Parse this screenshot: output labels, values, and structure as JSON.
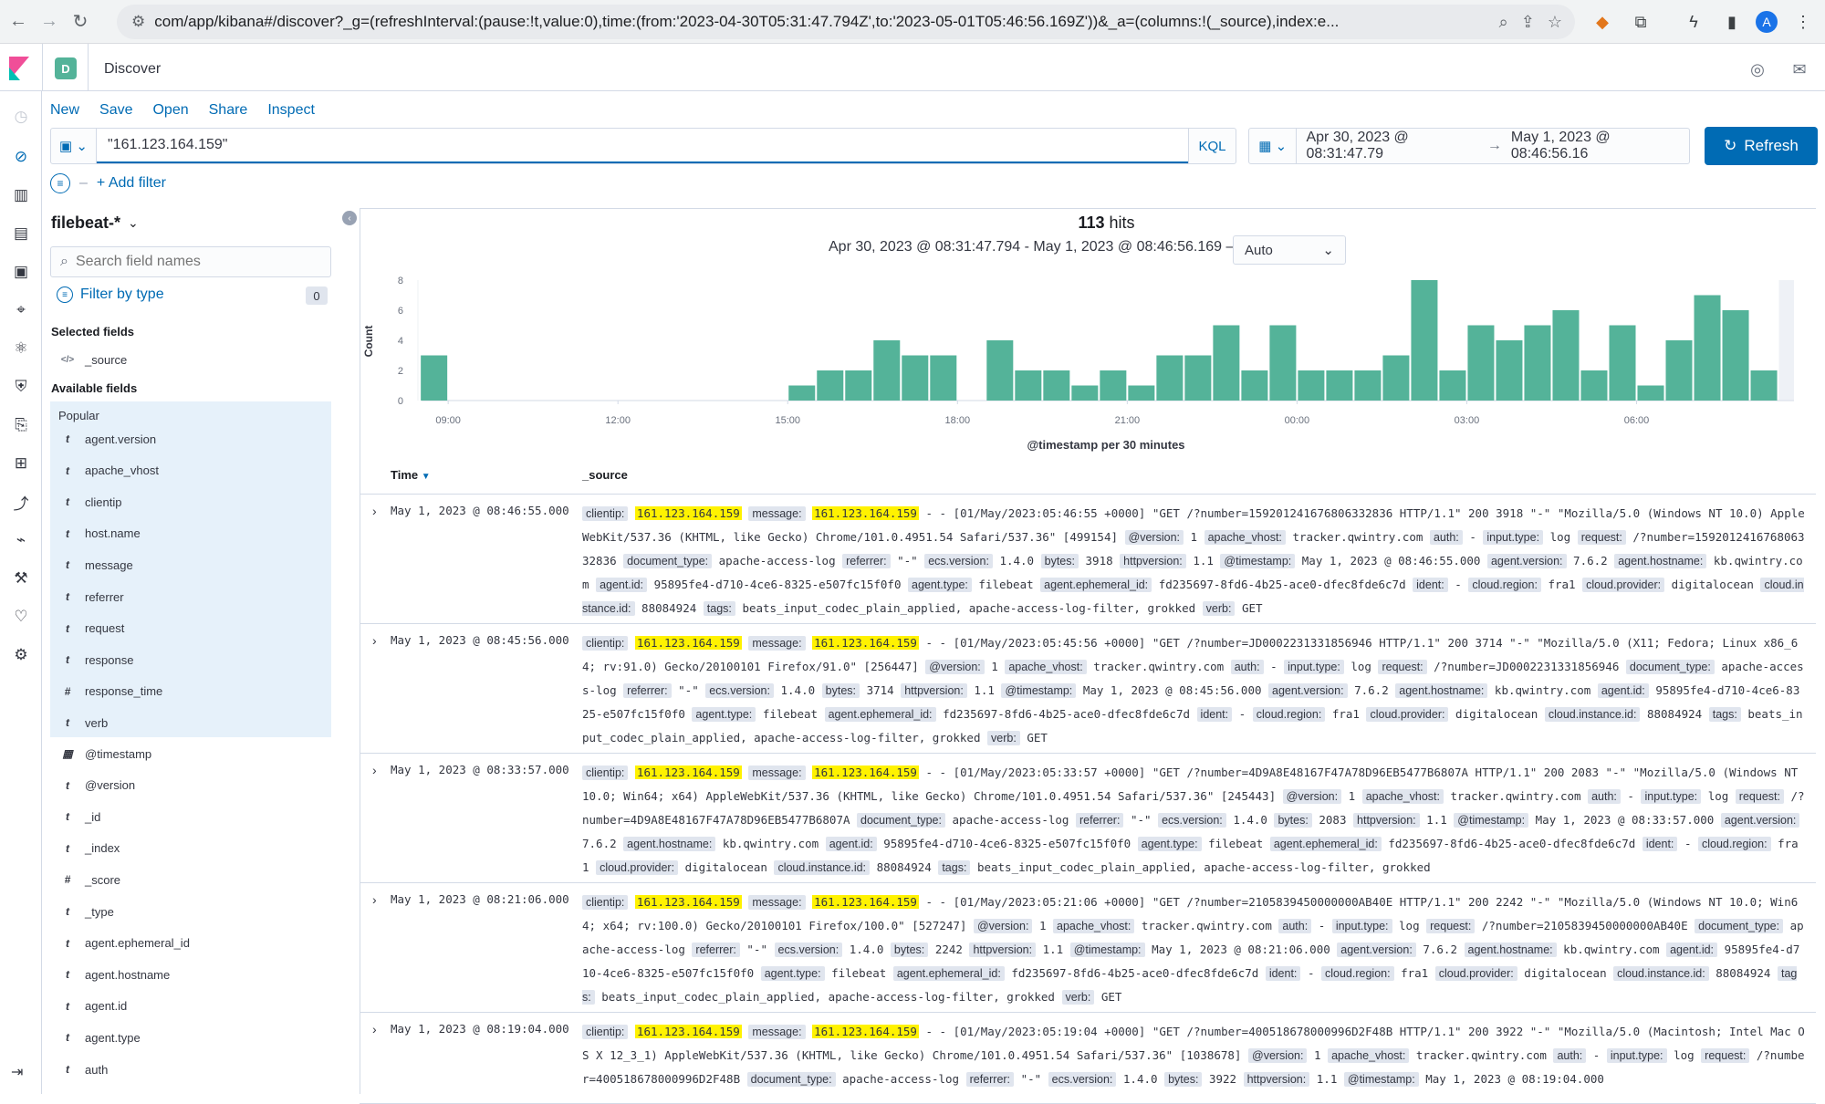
{
  "browser": {
    "url": "com/app/kibana#/discover?_g=(refreshInterval:(pause:!t,value:0),time:(from:'2023-04-30T05:31:47.794Z',to:'2023-05-01T05:46:56.169Z'))&_a=(columns:!(_source),index:e..."
  },
  "header": {
    "space_letter": "D",
    "breadcrumb": "Discover",
    "avatar_letter": "A"
  },
  "menu": {
    "new": "New",
    "save": "Save",
    "open": "Open",
    "share": "Share",
    "inspect": "Inspect"
  },
  "query": {
    "value": "\"161.123.164.159\"",
    "language": "KQL"
  },
  "time": {
    "start": "Apr 30, 2023 @ 08:31:47.79",
    "arrow": "→",
    "end": "May 1, 2023 @ 08:46:56.16"
  },
  "refresh_label": "Refresh",
  "filter": {
    "add": "+ Add filter"
  },
  "sidebar": {
    "index_pattern": "filebeat-*",
    "search_placeholder": "Search field names",
    "filter_by_type": "Filter by type",
    "filter_count": "0",
    "selected_label": "Selected fields",
    "selected": [
      {
        "type": "</>",
        "name": "_source"
      }
    ],
    "available_label": "Available fields",
    "popular_label": "Popular",
    "popular": [
      {
        "type": "t",
        "name": "agent.version"
      },
      {
        "type": "t",
        "name": "apache_vhost"
      },
      {
        "type": "t",
        "name": "clientip"
      },
      {
        "type": "t",
        "name": "host.name"
      },
      {
        "type": "t",
        "name": "message"
      },
      {
        "type": "t",
        "name": "referrer"
      },
      {
        "type": "t",
        "name": "request"
      },
      {
        "type": "t",
        "name": "response"
      },
      {
        "type": "#",
        "name": "response_time"
      },
      {
        "type": "t",
        "name": "verb"
      }
    ],
    "other": [
      {
        "type": "cal",
        "name": "@timestamp"
      },
      {
        "type": "t",
        "name": "@version"
      },
      {
        "type": "t",
        "name": "_id"
      },
      {
        "type": "t",
        "name": "_index"
      },
      {
        "type": "#",
        "name": "_score"
      },
      {
        "type": "t",
        "name": "_type"
      },
      {
        "type": "t",
        "name": "agent.ephemeral_id"
      },
      {
        "type": "t",
        "name": "agent.hostname"
      },
      {
        "type": "t",
        "name": "agent.id"
      },
      {
        "type": "t",
        "name": "agent.type"
      },
      {
        "type": "t",
        "name": "auth"
      }
    ]
  },
  "results": {
    "hits_count": "113",
    "hits_label": "hits",
    "range": "Apr 30, 2023 @ 08:31:47.794 - May 1, 2023 @ 08:46:56.169 —",
    "interval": "Auto"
  },
  "chart_data": {
    "type": "bar",
    "xlabel": "@timestamp per 30 minutes",
    "ylabel": "Count",
    "ylim": [
      0,
      8
    ],
    "yticks": [
      "0",
      "2",
      "4",
      "6",
      "8"
    ],
    "xticks": [
      "09:00",
      "12:00",
      "15:00",
      "18:00",
      "21:00",
      "00:00",
      "03:00",
      "06:00"
    ],
    "categories": [
      "15:00",
      "15:30",
      "16:00",
      "16:30",
      "17:00",
      "17:30",
      "18:00",
      "18:30",
      "19:00",
      "19:30",
      "20:00",
      "20:30",
      "21:00",
      "21:30",
      "22:00",
      "22:30",
      "23:00",
      "23:30",
      "00:00",
      "00:30",
      "01:00",
      "01:30",
      "02:00",
      "02:30",
      "03:00",
      "03:30",
      "04:00",
      "04:30",
      "05:00",
      "05:30",
      "06:00",
      "06:30",
      "07:00",
      "07:30",
      "08:00",
      "08:30"
    ],
    "values": [
      1,
      2,
      2,
      4,
      3,
      3,
      0,
      4,
      2,
      2,
      1,
      2,
      1,
      3,
      3,
      5,
      2,
      5,
      2,
      2,
      2,
      3,
      8,
      2,
      5,
      4,
      5,
      6,
      2,
      5,
      1,
      4,
      7,
      6,
      2,
      3
    ],
    "color": "#54b399"
  },
  "table": {
    "col_time": "Time",
    "col_source": "_source",
    "rows": [
      {
        "time": "May 1, 2023 @ 08:46:55.000",
        "parts": [
          [
            "clientip:",
            "161.123.164.159",
            "hl"
          ],
          [
            "message:",
            "161.123.164.159",
            "hl"
          ],
          [
            "",
            "- - [01/May/2023:05:46:55 +0000] \"GET /?number=159201241676806332836 HTTP/1.1\" 200 3918 \"-\" \"Mozilla/5.0 (Windows NT 10.0) AppleWebKit/537.36 (KHTML, like Gecko) Chrome/101.0.4951.54 Safari/537.36\" [499154]",
            ""
          ],
          [
            "@version:",
            "1",
            ""
          ],
          [
            "apache_vhost:",
            "tracker.qwintry.com",
            ""
          ],
          [
            "auth:",
            "-",
            ""
          ],
          [
            "input.type:",
            "log",
            ""
          ],
          [
            "request:",
            "/?number=159201241676806332836",
            ""
          ],
          [
            "document_type:",
            "apache-access-log",
            ""
          ],
          [
            "referrer:",
            "\"-\"",
            ""
          ],
          [
            "ecs.version:",
            "1.4.0",
            ""
          ],
          [
            "bytes:",
            "3918",
            ""
          ],
          [
            "httpversion:",
            "1.1",
            ""
          ],
          [
            "@timestamp:",
            "May 1, 2023 @ 08:46:55.000",
            ""
          ],
          [
            "agent.version:",
            "7.6.2",
            ""
          ],
          [
            "agent.hostname:",
            "kb.qwintry.com",
            ""
          ],
          [
            "agent.id:",
            "95895fe4-d710-4ce6-8325-e507fc15f0f0",
            ""
          ],
          [
            "agent.type:",
            "filebeat",
            ""
          ],
          [
            "agent.ephemeral_id:",
            "fd235697-8fd6-4b25-ace0-dfec8fde6c7d",
            ""
          ],
          [
            "ident:",
            "-",
            ""
          ],
          [
            "cloud.region:",
            "fra1",
            ""
          ],
          [
            "cloud.provider:",
            "digitalocean",
            ""
          ],
          [
            "cloud.instance.id:",
            "88084924",
            ""
          ],
          [
            "tags:",
            "beats_input_codec_plain_applied, apache-access-log-filter, grokked",
            ""
          ],
          [
            "verb:",
            "GET",
            ""
          ]
        ]
      },
      {
        "time": "May 1, 2023 @ 08:45:56.000",
        "parts": [
          [
            "clientip:",
            "161.123.164.159",
            "hl"
          ],
          [
            "message:",
            "161.123.164.159",
            "hl"
          ],
          [
            "",
            "- - [01/May/2023:05:45:56 +0000] \"GET /?number=JD0002231331856946 HTTP/1.1\" 200 3714 \"-\" \"Mozilla/5.0 (X11; Fedora; Linux x86_64; rv:91.0) Gecko/20100101 Firefox/91.0\" [256447]",
            ""
          ],
          [
            "@version:",
            "1",
            ""
          ],
          [
            "apache_vhost:",
            "tracker.qwintry.com",
            ""
          ],
          [
            "auth:",
            "-",
            ""
          ],
          [
            "input.type:",
            "log",
            ""
          ],
          [
            "request:",
            "/?number=JD0002231331856946",
            ""
          ],
          [
            "document_type:",
            "apache-access-log",
            ""
          ],
          [
            "referrer:",
            "\"-\"",
            ""
          ],
          [
            "ecs.version:",
            "1.4.0",
            ""
          ],
          [
            "bytes:",
            "3714",
            ""
          ],
          [
            "httpversion:",
            "1.1",
            ""
          ],
          [
            "@timestamp:",
            "May 1, 2023 @ 08:45:56.000",
            ""
          ],
          [
            "agent.version:",
            "7.6.2",
            ""
          ],
          [
            "agent.hostname:",
            "kb.qwintry.com",
            ""
          ],
          [
            "agent.id:",
            "95895fe4-d710-4ce6-8325-e507fc15f0f0",
            ""
          ],
          [
            "agent.type:",
            "filebeat",
            ""
          ],
          [
            "agent.ephemeral_id:",
            "fd235697-8fd6-4b25-ace0-dfec8fde6c7d",
            ""
          ],
          [
            "ident:",
            "-",
            ""
          ],
          [
            "cloud.region:",
            "fra1",
            ""
          ],
          [
            "cloud.provider:",
            "digitalocean",
            ""
          ],
          [
            "cloud.instance.id:",
            "88084924",
            ""
          ],
          [
            "tags:",
            "beats_input_codec_plain_applied, apache-access-log-filter, grokked",
            ""
          ],
          [
            "verb:",
            "GET",
            ""
          ]
        ]
      },
      {
        "time": "May 1, 2023 @ 08:33:57.000",
        "parts": [
          [
            "clientip:",
            "161.123.164.159",
            "hl"
          ],
          [
            "message:",
            "161.123.164.159",
            "hl"
          ],
          [
            "",
            "- - [01/May/2023:05:33:57 +0000] \"GET /?number=4D9A8E48167F47A78D96EB5477B6807A HTTP/1.1\" 200 2083 \"-\" \"Mozilla/5.0 (Windows NT 10.0; Win64; x64) AppleWebKit/537.36 (KHTML, like Gecko) Chrome/101.0.4951.54 Safari/537.36\" [245443]",
            ""
          ],
          [
            "@version:",
            "1",
            ""
          ],
          [
            "apache_vhost:",
            "tracker.qwintry.com",
            ""
          ],
          [
            "auth:",
            "-",
            ""
          ],
          [
            "input.type:",
            "log",
            ""
          ],
          [
            "request:",
            "/?number=4D9A8E48167F47A78D96EB5477B6807A",
            ""
          ],
          [
            "document_type:",
            "apache-access-log",
            ""
          ],
          [
            "referrer:",
            "\"-\"",
            ""
          ],
          [
            "ecs.version:",
            "1.4.0",
            ""
          ],
          [
            "bytes:",
            "2083",
            ""
          ],
          [
            "httpversion:",
            "1.1",
            ""
          ],
          [
            "@timestamp:",
            "May 1, 2023 @ 08:33:57.000",
            ""
          ],
          [
            "agent.version:",
            "7.6.2",
            ""
          ],
          [
            "agent.hostname:",
            "kb.qwintry.com",
            ""
          ],
          [
            "agent.id:",
            "95895fe4-d710-4ce6-8325-e507fc15f0f0",
            ""
          ],
          [
            "agent.type:",
            "filebeat",
            ""
          ],
          [
            "agent.ephemeral_id:",
            "fd235697-8fd6-4b25-ace0-dfec8fde6c7d",
            ""
          ],
          [
            "ident:",
            "-",
            ""
          ],
          [
            "cloud.region:",
            "fra1",
            ""
          ],
          [
            "cloud.provider:",
            "digitalocean",
            ""
          ],
          [
            "cloud.instance.id:",
            "88084924",
            ""
          ],
          [
            "tags:",
            "beats_input_codec_plain_applied, apache-access-log-filter, grokked",
            ""
          ]
        ]
      },
      {
        "time": "May 1, 2023 @ 08:21:06.000",
        "parts": [
          [
            "clientip:",
            "161.123.164.159",
            "hl"
          ],
          [
            "message:",
            "161.123.164.159",
            "hl"
          ],
          [
            "",
            "- - [01/May/2023:05:21:06 +0000] \"GET /?number=2105839450000000AB40E HTTP/1.1\" 200 2242 \"-\" \"Mozilla/5.0 (Windows NT 10.0; Win64; x64; rv:100.0) Gecko/20100101 Firefox/100.0\" [527247]",
            ""
          ],
          [
            "@version:",
            "1",
            ""
          ],
          [
            "apache_vhost:",
            "tracker.qwintry.com",
            ""
          ],
          [
            "auth:",
            "-",
            ""
          ],
          [
            "input.type:",
            "log",
            ""
          ],
          [
            "request:",
            "/?number=2105839450000000AB40E",
            ""
          ],
          [
            "document_type:",
            "apache-access-log",
            ""
          ],
          [
            "referrer:",
            "\"-\"",
            ""
          ],
          [
            "ecs.version:",
            "1.4.0",
            ""
          ],
          [
            "bytes:",
            "2242",
            ""
          ],
          [
            "httpversion:",
            "1.1",
            ""
          ],
          [
            "@timestamp:",
            "May 1, 2023 @ 08:21:06.000",
            ""
          ],
          [
            "agent.version:",
            "7.6.2",
            ""
          ],
          [
            "agent.hostname:",
            "kb.qwintry.com",
            ""
          ],
          [
            "agent.id:",
            "95895fe4-d710-4ce6-8325-e507fc15f0f0",
            ""
          ],
          [
            "agent.type:",
            "filebeat",
            ""
          ],
          [
            "agent.ephemeral_id:",
            "fd235697-8fd6-4b25-ace0-dfec8fde6c7d",
            ""
          ],
          [
            "ident:",
            "-",
            ""
          ],
          [
            "cloud.region:",
            "fra1",
            ""
          ],
          [
            "cloud.provider:",
            "digitalocean",
            ""
          ],
          [
            "cloud.instance.id:",
            "88084924",
            ""
          ],
          [
            "tags:",
            "beats_input_codec_plain_applied, apache-access-log-filter, grokked",
            ""
          ],
          [
            "verb:",
            "GET",
            ""
          ]
        ]
      },
      {
        "time": "May 1, 2023 @ 08:19:04.000",
        "parts": [
          [
            "clientip:",
            "161.123.164.159",
            "hl"
          ],
          [
            "message:",
            "161.123.164.159",
            "hl"
          ],
          [
            "",
            "- - [01/May/2023:05:19:04 +0000] \"GET /?number=400518678000996D2F48B HTTP/1.1\" 200 3922 \"-\" \"Mozilla/5.0 (Macintosh; Intel Mac OS X 12_3_1) AppleWebKit/537.36 (KHTML, like Gecko) Chrome/101.0.4951.54 Safari/537.36\" [1038678]",
            ""
          ],
          [
            "@version:",
            "1",
            ""
          ],
          [
            "apache_vhost:",
            "tracker.qwintry.com",
            ""
          ],
          [
            "auth:",
            "-",
            ""
          ],
          [
            "input.type:",
            "log",
            ""
          ],
          [
            "request:",
            "/?number=400518678000996D2F48B",
            ""
          ],
          [
            "document_type:",
            "apache-access-log",
            ""
          ],
          [
            "referrer:",
            "\"-\"",
            ""
          ],
          [
            "ecs.version:",
            "1.4.0",
            ""
          ],
          [
            "bytes:",
            "3922",
            ""
          ],
          [
            "httpversion:",
            "1.1",
            ""
          ],
          [
            "@timestamp:",
            "May 1, 2023 @ 08:19:04.000",
            ""
          ]
        ]
      }
    ]
  }
}
